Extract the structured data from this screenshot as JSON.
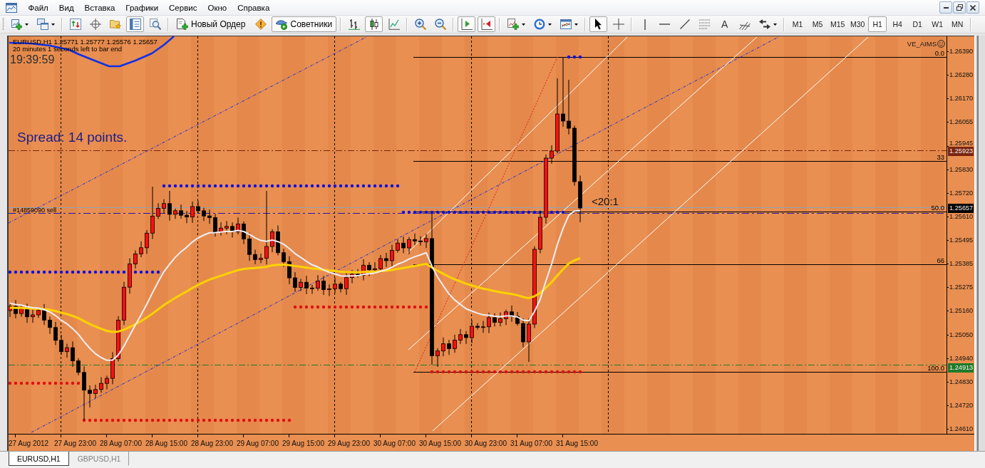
{
  "menu": [
    "Файл",
    "Вид",
    "Вставка",
    "Графики",
    "Сервис",
    "Окно",
    "Справка"
  ],
  "toolbar": {
    "groups": [
      [
        {
          "kind": "new-chart",
          "pressed": false
        },
        {
          "kind": "profiles",
          "pressed": false
        }
      ],
      [
        {
          "kind": "market-watch",
          "pressed": false
        },
        {
          "kind": "data-window",
          "pressed": false
        },
        {
          "kind": "navigator",
          "pressed": false
        },
        {
          "kind": "terminal",
          "pressed": true
        },
        {
          "kind": "tester",
          "pressed": false
        }
      ],
      [
        {
          "kind": "new-order",
          "label": "Новый Ордер",
          "pressed": false
        },
        {
          "kind": "alert",
          "pressed": false
        },
        {
          "kind": "experts",
          "label": "Советники",
          "pressed": true
        }
      ],
      [
        {
          "kind": "bar-chart",
          "pressed": false
        },
        {
          "kind": "candlesticks",
          "pressed": true
        },
        {
          "kind": "line-chart",
          "pressed": false
        }
      ],
      [
        {
          "kind": "zoom-in",
          "pressed": false
        },
        {
          "kind": "zoom-out",
          "pressed": false
        }
      ],
      [
        {
          "kind": "chart-shift",
          "pressed": true
        },
        {
          "kind": "auto-scroll",
          "pressed": true
        }
      ],
      [
        {
          "kind": "indicators",
          "pressed": false
        },
        {
          "kind": "periods",
          "pressed": false
        },
        {
          "kind": "templates",
          "pressed": false
        }
      ],
      [
        {
          "kind": "cursor",
          "pressed": true
        },
        {
          "kind": "crosshair",
          "pressed": false
        }
      ],
      [
        {
          "kind": "vertical-line",
          "pressed": false
        },
        {
          "kind": "horizontal-line",
          "pressed": false
        },
        {
          "kind": "trend-line",
          "pressed": false
        },
        {
          "kind": "fibonacci",
          "pressed": false
        },
        {
          "kind": "text",
          "label": "A",
          "pressed": false
        },
        {
          "kind": "pitchfork",
          "pressed": false
        },
        {
          "kind": "arrows",
          "pressed": false
        }
      ]
    ],
    "timeframes": [
      {
        "label": "M1",
        "selected": false
      },
      {
        "label": "M5",
        "selected": false
      },
      {
        "label": "M15",
        "selected": false
      },
      {
        "label": "M30",
        "selected": false
      },
      {
        "label": "H1",
        "selected": true
      },
      {
        "label": "H4",
        "selected": false
      },
      {
        "label": "D1",
        "selected": false
      },
      {
        "label": "W1",
        "selected": false
      },
      {
        "label": "MN",
        "selected": false
      }
    ]
  },
  "chart": {
    "header": "EURUSD,H1 1.25771 1.25777 1.25576 1.25657",
    "countdown": "20 minutes 1 seconds left to bar end",
    "clock": "19:39:59",
    "spread": "Spread: 14 points.",
    "indicator_name": "VE_AIMS",
    "ratio_label": "<20:1",
    "order_label": "#14859090 sell",
    "fib_levels": [
      "0.0",
      "33",
      "50.0",
      "66",
      "100.0"
    ],
    "price_axis": [
      "1.26390",
      "1.26280",
      "1.26170",
      "1.26055",
      "1.25945",
      "1.25830",
      "1.25720",
      "1.25610",
      "1.25495",
      "1.25385",
      "1.25275",
      "1.25160",
      "1.25050",
      "1.24940",
      "1.24830",
      "1.24720",
      "1.24610"
    ],
    "price_markers": [
      {
        "kind": "level",
        "price": "1.25923",
        "color": "#7a2410"
      },
      {
        "kind": "bid",
        "price": "1.25657",
        "color": "#000000"
      },
      {
        "kind": "level",
        "price": "1.24913",
        "color": "#1f7a28"
      }
    ],
    "time_axis": [
      "27 Aug 2012",
      "27 Aug 23:00",
      "28 Aug 07:00",
      "28 Aug 15:00",
      "28 Aug 23:00",
      "29 Aug 07:00",
      "29 Aug 15:00",
      "29 Aug 23:00",
      "30 Aug 07:00",
      "30 Aug 15:00",
      "30 Aug 23:00",
      "31 Aug 07:00",
      "31 Aug 15:00"
    ]
  },
  "tabs": [
    {
      "label": "EURUSD,H1",
      "selected": true
    },
    {
      "label": "GBPUSD,H1",
      "selected": false
    }
  ]
}
